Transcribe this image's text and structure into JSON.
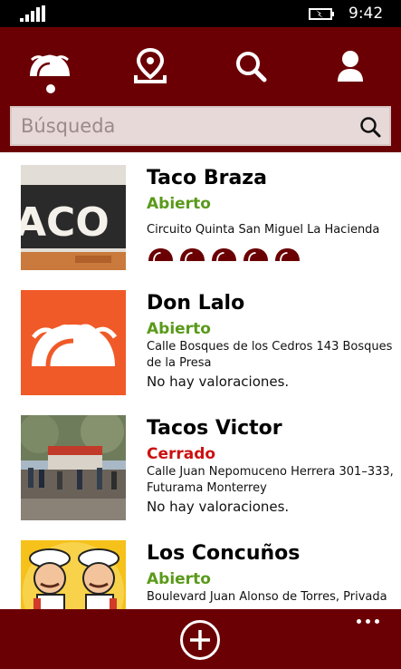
{
  "status_bar": {
    "time": "9:42",
    "signal_icon": "signal-bars-icon",
    "battery_icon": "battery-charging-icon"
  },
  "nav": {
    "items": [
      {
        "name": "taco-icon",
        "selected": true
      },
      {
        "name": "map-pin-icon",
        "selected": false
      },
      {
        "name": "search-icon",
        "selected": false
      },
      {
        "name": "user-icon",
        "selected": false
      }
    ]
  },
  "search": {
    "placeholder": "Búsqueda",
    "value": ""
  },
  "restaurants": [
    {
      "name": "Taco Braza",
      "status": "Abierto",
      "address": "Circuito Quinta San Miguel  La Hacienda",
      "rating": 5,
      "rating_text": ""
    },
    {
      "name": "Don Lalo",
      "status": "Abierto",
      "address": "Calle Bosques de los Cedros 143 Bosques de la Presa",
      "rating": 0,
      "rating_text": "No hay valoraciones."
    },
    {
      "name": "Tacos Victor",
      "status": "Cerrado",
      "address": "Calle Juan Nepomuceno Herrera 301–333, Futurama Monterrey",
      "rating": 0,
      "rating_text": "No hay valoraciones."
    },
    {
      "name": "Los Concuños",
      "status": "Abierto",
      "address": "Boulevard Juan Alonso de Torres, Privada",
      "rating": 0,
      "rating_text": ""
    }
  ],
  "colors": {
    "brand": "#6b0004",
    "open": "#5a9a1a",
    "closed": "#cc1111",
    "accent": "#f05a28"
  },
  "bottom_bar": {
    "add_icon": "add-circle-icon",
    "more_icon": "more-dots-icon"
  }
}
